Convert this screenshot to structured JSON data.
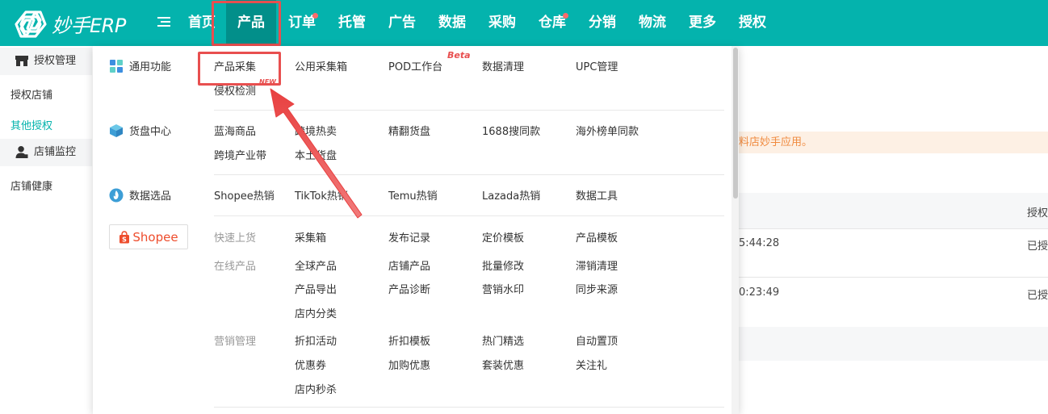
{
  "logo": {
    "text": "妙手ERP"
  },
  "nav": {
    "home": "首页",
    "product": "产品",
    "orders": "订单",
    "hosting": "托管",
    "ads": "广告",
    "data": "数据",
    "purchase": "采购",
    "warehouse": "仓库",
    "distribution": "分销",
    "logistics": "物流",
    "more": "更多",
    "auth": "授权"
  },
  "sidebar": {
    "group1": "授权管理",
    "item_auth_shop": "授权店铺",
    "item_other_auth": "其他授权",
    "group2": "店铺监控",
    "item_shop_health": "店铺健康"
  },
  "background": {
    "notice": "料店妙手应用。",
    "col_header": "授权",
    "row1_time": "5:44:28",
    "row1_status": "已授",
    "row2_time": "0:23:49",
    "row2_status": "已授"
  },
  "dropdown": {
    "general": {
      "title": "通用功能",
      "items": [
        "产品采集",
        "公用采集箱",
        "POD工作台",
        "数据清理",
        "UPC管理",
        "侵权检测"
      ],
      "beta": "Beta",
      "new": "NEW"
    },
    "sourcing": {
      "title": "货盘中心",
      "items": [
        "蓝海商品",
        "跨境热卖",
        "精翻货盘",
        "1688搜同款",
        "海外榜单同款",
        "跨境产业带",
        "本土货盘"
      ]
    },
    "selection": {
      "title": "数据选品",
      "items": [
        "Shopee热销",
        "TikTok热销",
        "Temu热销",
        "Lazada热销",
        "数据工具"
      ]
    },
    "shopee": {
      "label": "Shopee",
      "quick_label": "快速上货",
      "quick_items": [
        "采集箱",
        "发布记录",
        "定价模板",
        "产品模板"
      ],
      "online_label": "在线产品",
      "online_items": [
        "全球产品",
        "店铺产品",
        "批量修改",
        "滞销清理",
        "产品导出",
        "产品诊断",
        "营销水印",
        "同步来源",
        "店内分类"
      ],
      "marketing_label": "营销管理",
      "marketing_items": [
        "折扣活动",
        "折扣模板",
        "热门精选",
        "自动置顶",
        "优惠券",
        "加购优惠",
        "套装优惠",
        "关注礼",
        "店内秒杀"
      ]
    }
  }
}
